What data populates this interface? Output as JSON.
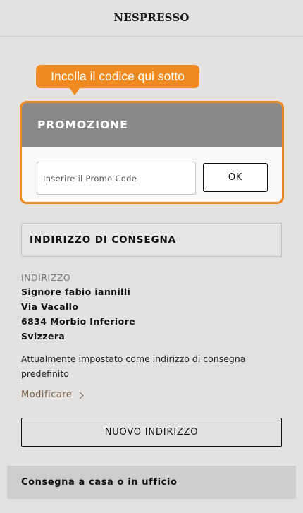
{
  "header": {
    "logo": "NESPRESSO"
  },
  "tooltip": {
    "text": "Incolla il codice qui sotto"
  },
  "promo": {
    "title": "PROMOZIONE",
    "input_placeholder": "Inserire il Promo Code",
    "input_value": "",
    "ok_label": "OK"
  },
  "delivery_address": {
    "section_title": "INDIRIZZO DI CONSEGNA",
    "label": "INDIRIZZO",
    "lines": [
      "Signore fabio iannilli",
      "Via Vacallo",
      "6834 Morbio Inferiore",
      "Svizzera"
    ],
    "default_note": "Attualmente impostato come indirizzo di consegna predefinito",
    "modify_label": "Modificare",
    "new_address_label": "NUOVO INDIRIZZO"
  },
  "delivery_option": {
    "label": "Consegna a casa o in ufficio"
  },
  "colors": {
    "accent": "#ee8a20",
    "promo_header": "#8b8988",
    "background": "#e3e2e1"
  }
}
